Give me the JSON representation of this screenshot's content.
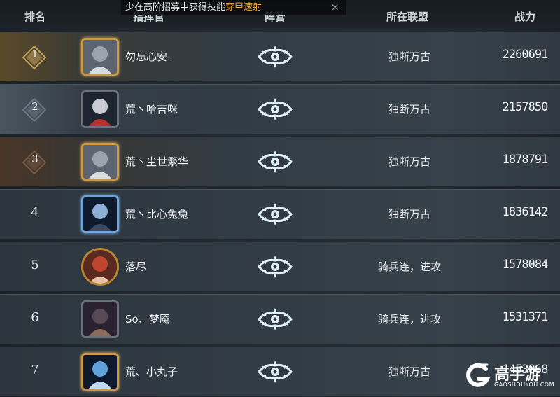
{
  "header": {
    "rank": "排名",
    "commander": "指挥官",
    "faction": "阵营",
    "alliance": "所在联盟",
    "power": "战力"
  },
  "toast": {
    "prefix": "少",
    "text": "在高阶招募中获得技能",
    "highlight": "穿甲速射",
    "close": "×"
  },
  "rows": [
    {
      "rank": "1",
      "name": "勿忘心安.",
      "alliance": "独断万古",
      "power": "2260691",
      "frame": "gold",
      "avatar": "silver-hair-woman"
    },
    {
      "rank": "2",
      "name": "荒丶哈吉咪",
      "alliance": "独断万古",
      "power": "2157850",
      "frame": "plain",
      "avatar": "mech-ship"
    },
    {
      "rank": "3",
      "name": "荒丶尘世繁华",
      "alliance": "独断万古",
      "power": "1878791",
      "frame": "gold",
      "avatar": "silver-hair-woman"
    },
    {
      "rank": "4",
      "name": "荒丶比心兔兔",
      "alliance": "独断万古",
      "power": "1836142",
      "frame": "blue",
      "avatar": "space-vehicle"
    },
    {
      "rank": "5",
      "name": "落尽",
      "alliance": "骑兵连，进攻",
      "power": "1578084",
      "frame": "crown",
      "avatar": "red-hair-woman"
    },
    {
      "rank": "6",
      "name": "So、梦魇",
      "alliance": "骑兵连，进攻",
      "power": "1531371",
      "frame": "plain",
      "avatar": "dark-creature"
    },
    {
      "rank": "7",
      "name": "荒、小丸子",
      "alliance": "独断万古",
      "power": "1453068",
      "frame": "gold",
      "avatar": "crystal-emblem"
    }
  ],
  "watermark": {
    "cn": "高手游",
    "en": "GAOSHOUYOU.COM"
  },
  "colors": {
    "highlight": "#f2a93a",
    "gold": "#c89a45",
    "blue": "#6fa4d9"
  }
}
